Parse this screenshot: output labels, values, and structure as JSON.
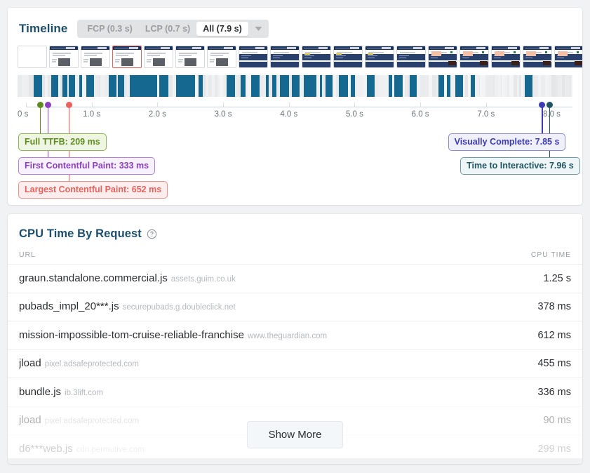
{
  "timeline": {
    "title": "Timeline",
    "segmented": {
      "options": [
        {
          "label": "FCP (0.3 s)",
          "active": false
        },
        {
          "label": "LCP (0.7 s)",
          "active": false
        },
        {
          "label": "All (7.9 s)",
          "active": true
        }
      ],
      "caret_icon": "chevron-down-icon"
    },
    "axis": {
      "ticks": [
        "0 s",
        "1.0 s",
        "2.0 s",
        "3.0 s",
        "4.0 s",
        "5.0 s",
        "6.0 s",
        "7.0 s",
        "8.0 s"
      ],
      "range_start_s": 0,
      "range_end_s": 8.55
    },
    "markers": [
      {
        "label": "Full TTFB: 209 ms",
        "time_s": 0.209,
        "color": "#5f8c1e",
        "bg": "#eef6e3",
        "border": "#8fb256"
      },
      {
        "label": "First Contentful Paint: 333 ms",
        "time_s": 0.333,
        "color": "#8a3fc0",
        "bg": "#f7f0fd",
        "border": "#b183d8"
      },
      {
        "label": "Largest Contentful Paint: 652 ms",
        "time_s": 0.652,
        "color": "#e8625d",
        "bg": "#fdeeed",
        "border": "#ef8f8b"
      },
      {
        "label": "Visually Complete: 7.85 s",
        "time_s": 7.85,
        "color": "#3b3bb5",
        "bg": "#f0f0fc",
        "border": "#8a8ad8"
      },
      {
        "label": "Time to Interactive: 7.96 s",
        "time_s": 7.96,
        "color": "#1f5560",
        "bg": "#eef5f6",
        "border": "#6f9aa2"
      }
    ],
    "filmstrip_count": 19,
    "filmstrip_selected_index": 3,
    "waterfall": {
      "bar_color": "#15688f",
      "bar_color_alt": "#8e0b52",
      "idle_color": "#e2e4e6"
    }
  },
  "cpu": {
    "title": "CPU Time By Request",
    "help_icon": "help-circle-icon",
    "columns": [
      "URL",
      "CPU TIME"
    ],
    "rows": [
      {
        "name": "graun.standalone.commercial.js",
        "host": "assets.guim.co.uk",
        "time": "1.25 s",
        "fade": 0
      },
      {
        "name": "pubads_impl_20***.js",
        "host": "securepubads.g.doubleclick.net",
        "time": "378 ms",
        "fade": 0
      },
      {
        "name": "mission-impossible-tom-cruise-reliable-franchise",
        "host": "www.theguardian.com",
        "time": "612 ms",
        "fade": 0
      },
      {
        "name": "jload",
        "host": "pixel.adsafeprotected.com",
        "time": "455 ms",
        "fade": 0
      },
      {
        "name": "bundle.js",
        "host": "ib.3lift.com",
        "time": "336 ms",
        "fade": 0
      },
      {
        "name": "jload",
        "host": "pixel.adsafeprotected.com",
        "time": "90 ms",
        "fade": 1
      },
      {
        "name": "d6***web.js",
        "host": "cdn.permutive.com",
        "time": "299 ms",
        "fade": 2
      }
    ],
    "show_more_label": "Show More"
  }
}
